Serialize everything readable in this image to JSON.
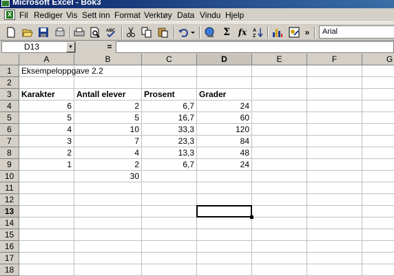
{
  "window": {
    "title": "Microsoft Excel - Bok3"
  },
  "menu": {
    "doc_icon": "X",
    "items": [
      {
        "label": "Fil",
        "name": "menu-fil"
      },
      {
        "label": "Rediger",
        "name": "menu-rediger"
      },
      {
        "label": "Vis",
        "name": "menu-vis"
      },
      {
        "label": "Sett inn",
        "name": "menu-sett-inn"
      },
      {
        "label": "Format",
        "name": "menu-format"
      },
      {
        "label": "Verktøy",
        "name": "menu-verktoy"
      },
      {
        "label": "Data",
        "name": "menu-data"
      },
      {
        "label": "Vindu",
        "name": "menu-vindu"
      },
      {
        "label": "Hjelp",
        "name": "menu-hjelp"
      }
    ]
  },
  "toolbar": {
    "icons": [
      "new-icon",
      "open-icon",
      "save-icon",
      "permission-icon",
      "print-icon",
      "print-preview-icon",
      "spelling-icon",
      "cut-icon",
      "copy-icon",
      "paste-icon",
      "undo-icon",
      "undo-dropdown-icon",
      "insert-hyperlink-icon",
      "autosum-icon",
      "function-icon",
      "sort-ascending-icon",
      "chart-wizard-icon",
      "drawing-icon",
      "toolbar-options-icon"
    ],
    "autosum_glyph": "Σ",
    "function_glyph": "fx",
    "more_glyph": "»",
    "font_name": "Arial"
  },
  "formula_bar": {
    "name_box": "D13",
    "equals": "=",
    "formula": ""
  },
  "sheet": {
    "columns": [
      "A",
      "B",
      "C",
      "D",
      "E",
      "F",
      "G"
    ],
    "selected_column": "D",
    "selected_row": 13,
    "rows": [
      {
        "n": "1",
        "cells": [
          "Eksempeloppgave 2.2",
          "",
          "",
          "",
          "",
          "",
          ""
        ]
      },
      {
        "n": "2",
        "cells": [
          "",
          "",
          "",
          "",
          "",
          "",
          ""
        ]
      },
      {
        "n": "3",
        "cells": [
          "Karakter",
          "Antall elever",
          "Prosent",
          "Grader",
          "",
          "",
          ""
        ]
      },
      {
        "n": "4",
        "cells": [
          "6",
          "2",
          "6,7",
          "24",
          "",
          "",
          ""
        ]
      },
      {
        "n": "5",
        "cells": [
          "5",
          "5",
          "16,7",
          "60",
          "",
          "",
          ""
        ]
      },
      {
        "n": "6",
        "cells": [
          "4",
          "10",
          "33,3",
          "120",
          "",
          "",
          ""
        ]
      },
      {
        "n": "7",
        "cells": [
          "3",
          "7",
          "23,3",
          "84",
          "",
          "",
          ""
        ]
      },
      {
        "n": "8",
        "cells": [
          "2",
          "4",
          "13,3",
          "48",
          "",
          "",
          ""
        ]
      },
      {
        "n": "9",
        "cells": [
          "1",
          "2",
          "6,7",
          "24",
          "",
          "",
          ""
        ]
      },
      {
        "n": "10",
        "cells": [
          "",
          "30",
          "",
          "",
          "",
          "",
          ""
        ]
      },
      {
        "n": "11",
        "cells": [
          "",
          "",
          "",
          "",
          "",
          "",
          ""
        ]
      },
      {
        "n": "12",
        "cells": [
          "",
          "",
          "",
          "",
          "",
          "",
          ""
        ]
      },
      {
        "n": "13",
        "cells": [
          "",
          "",
          "",
          "",
          "",
          "",
          ""
        ]
      },
      {
        "n": "14",
        "cells": [
          "",
          "",
          "",
          "",
          "",
          "",
          ""
        ]
      },
      {
        "n": "15",
        "cells": [
          "",
          "",
          "",
          "",
          "",
          "",
          ""
        ]
      },
      {
        "n": "16",
        "cells": [
          "",
          "",
          "",
          "",
          "",
          "",
          ""
        ]
      },
      {
        "n": "17",
        "cells": [
          "",
          "",
          "",
          "",
          "",
          "",
          ""
        ]
      },
      {
        "n": "18",
        "cells": [
          "",
          "",
          "",
          "",
          "",
          "",
          ""
        ]
      }
    ]
  }
}
